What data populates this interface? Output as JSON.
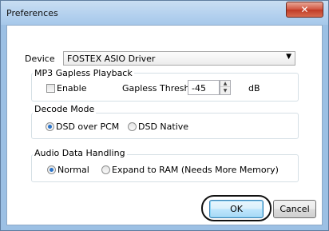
{
  "window": {
    "title": "Preferences",
    "close_label": "✕"
  },
  "device": {
    "label": "Device",
    "selected": "FOSTEX ASIO Driver",
    "arrow": "▼"
  },
  "mp3_gapless": {
    "title": "MP3 Gapless Playback",
    "enable_label": "Enable",
    "enable_checked": false,
    "threshold_label": "Gapless Threshold",
    "threshold_value": "-45",
    "unit": "dB",
    "spin_up": "▲",
    "spin_down": "▼"
  },
  "decode_mode": {
    "title": "Decode Mode",
    "options": [
      "DSD over PCM",
      "DSD Native"
    ],
    "selected": "DSD over PCM"
  },
  "audio_data": {
    "title": "Audio Data Handling",
    "options": [
      "Normal",
      "Expand to RAM (Needs More Memory)"
    ],
    "selected": "Normal"
  },
  "buttons": {
    "ok": "OK",
    "cancel": "Cancel"
  }
}
